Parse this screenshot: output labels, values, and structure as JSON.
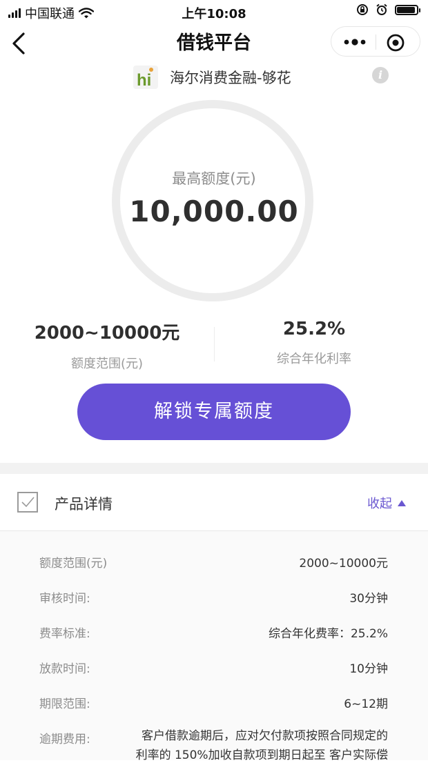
{
  "status_bar": {
    "carrier": "中国联通",
    "time": "上午10:08"
  },
  "nav": {
    "title": "借钱平台"
  },
  "brand": {
    "logo_text": "hi",
    "name": "海尔消费金融-够花",
    "info_glyph": "i"
  },
  "quota": {
    "label": "最高额度(元)",
    "value": "10,000.00"
  },
  "stats": [
    {
      "value": "2000~10000元",
      "label": "额度范围(元)"
    },
    {
      "value": "25.2%",
      "label": "综合年化利率"
    }
  ],
  "cta": {
    "label": "解锁专属额度"
  },
  "details": {
    "title": "产品详情",
    "collapse_label": "收起",
    "rows": [
      {
        "label": "额度范围(元)",
        "value": "2000~10000元"
      },
      {
        "label": "审核时间:",
        "value": "30分钟"
      },
      {
        "label": "费率标准:",
        "value": "综合年化费率：25.2%"
      },
      {
        "label": "放款时间:",
        "value": "10分钟"
      },
      {
        "label": "期限范围:",
        "value": "6~12期"
      }
    ],
    "overdue": {
      "label": "逾期费用:",
      "line1": "客户借款逾期后，应对欠付款项按照合同规定的",
      "line2": "利率的 150%加收自款项到期日起至 客户实际偿"
    }
  },
  "colors": {
    "accent": "#6650d6",
    "link": "#6a57d0"
  },
  "icons": [
    "signal-icon",
    "wifi-icon",
    "orientation-lock-icon",
    "alarm-icon",
    "battery-icon",
    "back-icon",
    "more-icon",
    "close-target-icon",
    "info-icon",
    "check-icon",
    "triangle-up-icon"
  ]
}
